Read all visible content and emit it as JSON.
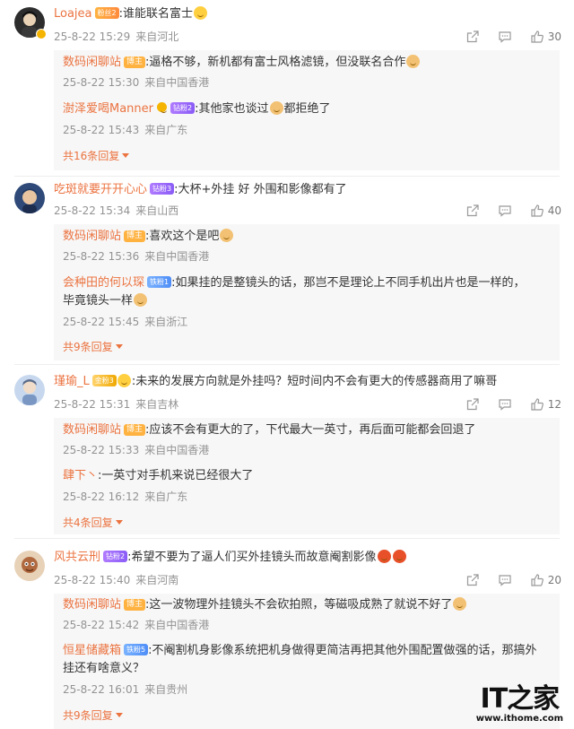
{
  "threads": [
    {
      "user": "Loajea",
      "badge": "粉丝2",
      "text": ":谁能联名富士",
      "time": "25-8-22 15:29",
      "location": "来自河北",
      "likes": "30",
      "avatar_color": "#2d2d2d",
      "replies": [
        {
          "user": "数码闲聊站",
          "badge": "博主",
          "text": ":逼格不够，新机都有富士风格滤镜，但没联名合作",
          "time": "25-8-22 15:30",
          "location": "来自中国香港"
        },
        {
          "user": "澍泽爱喝Manner",
          "badge": "钻粉2",
          "text": ":其他家也谈过",
          "text2": "都拒绝了",
          "time": "25-8-22 15:43",
          "location": "来自广东"
        }
      ],
      "more": "共16条回复"
    },
    {
      "user": "吃斑就要开开心心",
      "badge": "钻粉3",
      "text": ":大杯+外挂  好  外围和影像都有了",
      "time": "25-8-22 15:34",
      "location": "来自山西",
      "likes": "40",
      "avatar_color": "#2f4a78",
      "replies": [
        {
          "user": "数码闲聊站",
          "badge": "博主",
          "text": ":喜欢这个是吧",
          "time": "25-8-22 15:36",
          "location": "来自中国香港"
        },
        {
          "user": "会种田的何以琛",
          "badge": "铁粉1",
          "text": ":如果挂的是整镜头的话，那岂不是理论上不同手机出片也是一样的，",
          "text2": "毕竟镜头一样",
          "time": "25-8-22 15:45",
          "location": "来自浙江"
        }
      ],
      "more": "共9条回复"
    },
    {
      "user": "瑾瑜_L",
      "badge": "金粉3",
      "text": ":未来的发展方向就是外挂吗？短时间内不会有更大的传感器商用了嘛哥",
      "time": "25-8-22 15:31",
      "location": "来自吉林",
      "likes": "12",
      "avatar_color": "#9fb8d8",
      "replies": [
        {
          "user": "数码闲聊站",
          "badge": "博主",
          "text": ":应该不会有更大的了，下代最大一英寸，再后面可能都会回退了",
          "time": "25-8-22 15:33",
          "location": "来自中国香港"
        },
        {
          "user": "肆下丶",
          "badge": "",
          "text": ":一英寸对手机来说已经很大了",
          "time": "25-8-22 16:12",
          "location": "来自广东"
        }
      ],
      "more": "共4条回复"
    },
    {
      "user": "风共云刑",
      "badge": "钻粉2",
      "text": ":希望不要为了逼人们买外挂镜头而故意阉割影像",
      "time": "25-8-22 15:40",
      "location": "来自河南",
      "likes": "20",
      "avatar_color": "#c9a07a",
      "replies": [
        {
          "user": "数码闲聊站",
          "badge": "博主",
          "text": ":这一波物理外挂镜头不会砍拍照，等磁吸成熟了就说不好了",
          "time": "25-8-22 15:42",
          "location": "来自中国香港"
        },
        {
          "user": "恒星储藏箱",
          "badge": "铁粉5",
          "text": ":不阉割机身影像系统把机身做得更简洁再把其他外围配置做强的话，那搞外",
          "text2": "挂还有啥意义？",
          "time": "25-8-22 16:01",
          "location": "来自贵州"
        }
      ],
      "more": "共9条回复"
    }
  ],
  "watermark": {
    "logo": "IT之家",
    "url": "www.ithome.com"
  },
  "icons": {
    "share": "share-icon",
    "comment": "comment-icon",
    "like": "thumbs-up-icon"
  }
}
